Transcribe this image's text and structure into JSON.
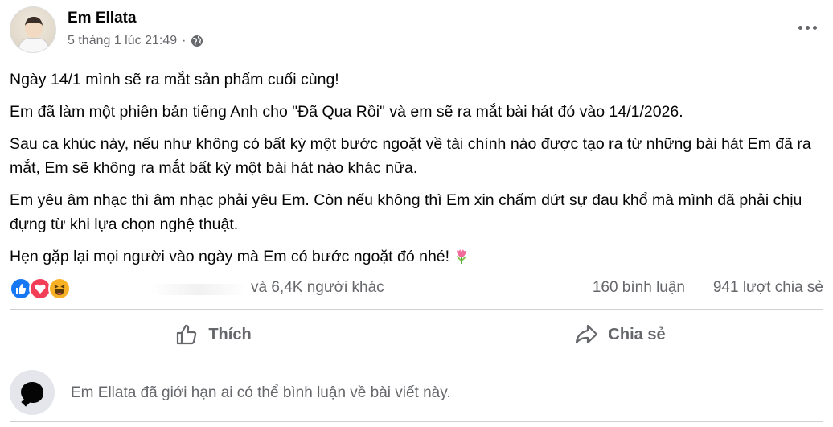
{
  "post": {
    "author": "Em Ellata",
    "timestamp": "5 tháng 1 lúc 21:49",
    "meta_separator": "·",
    "privacy_icon": "globe-icon",
    "paragraphs": [
      "Ngày 14/1 mình sẽ ra mắt sản phẩm cuối cùng!",
      "Em đã làm một phiên bản tiếng Anh cho \"Đã Qua Rồi\" và em sẽ ra mắt bài hát đó vào 14/1/2026.",
      "Sau ca khúc này, nếu như không có bất kỳ một bước ngoặt về tài chính nào được tạo ra từ những bài hát Em đã ra mắt, Em sẽ không ra mắt bất kỳ một bài hát nào khác nữa.",
      "Em yêu âm nhạc thì âm nhạc phải yêu Em. Còn nếu không thì Em xin chấm dứt sự đau khổ mà mình đã phải chịu đựng từ khi lựa chọn nghệ thuật.",
      "Hẹn gặp lại mọi người vào ngày mà Em có bước ngoặt đó nhé!"
    ],
    "trailing_emoji": "tulip-emoji"
  },
  "stats": {
    "reactions": [
      "like",
      "love",
      "haha"
    ],
    "reactions_text": "và 6,4K người khác",
    "comments": "160 bình luận",
    "shares": "941 lượt chia sẻ"
  },
  "actions": {
    "like_label": "Thích",
    "share_label": "Chia sẻ"
  },
  "restriction": {
    "text": "Em Ellata đã giới hạn ai có thể bình luận về bài viết này."
  },
  "colors": {
    "like": "#1877f2",
    "love": "#f33e58",
    "haha": "#f7b125",
    "secondary_text": "#65676b"
  }
}
